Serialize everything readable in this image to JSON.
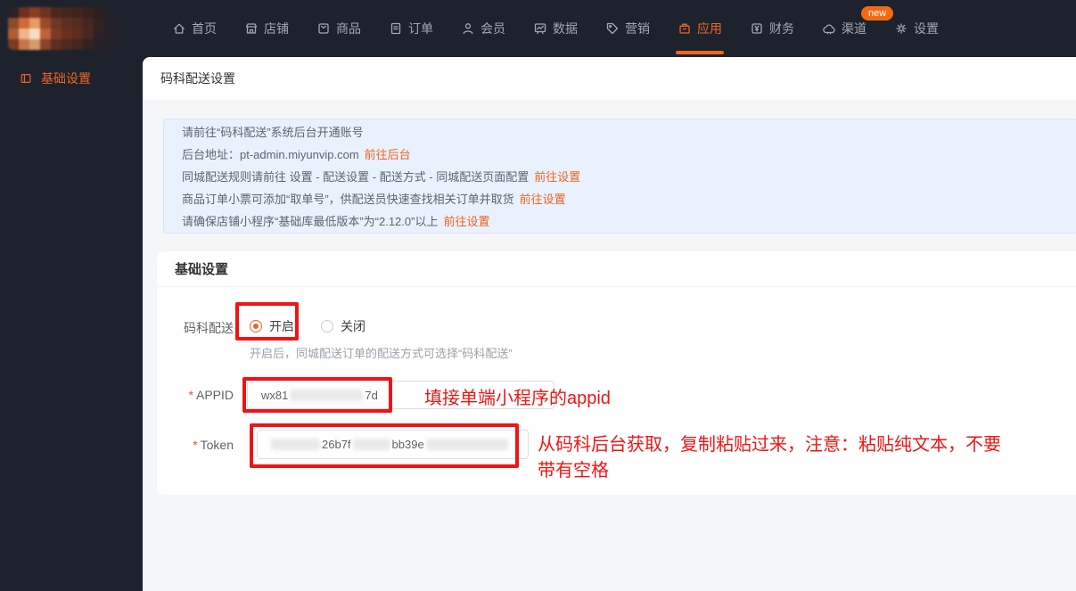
{
  "colors": {
    "accent": "#ee6425",
    "annotation_red": "#f01414",
    "dark_bg": "#1e222d",
    "notice_bg": "#e9f1fc",
    "notice_border": "#d4e3f6",
    "page_bg": "#f5f6f8"
  },
  "brand": {
    "logo_mosaic": [
      "#2a2129",
      "#6b3020",
      "#8a3d22",
      "#6e3322",
      "#4a2820",
      "#43261f",
      "#3f241e",
      "#35211f",
      "#2b1f22",
      "#242028",
      "#8a4a2c",
      "#d06a38",
      "#e89a62",
      "#9a4a28",
      "#6e3824",
      "#5e2f20",
      "#552c20",
      "#46261e",
      "#33211f",
      "#262029",
      "#b05c34",
      "#f0b488",
      "#f6dcc2",
      "#c06038",
      "#7a3a24",
      "#68301f",
      "#5c2c1e",
      "#482820",
      "#2e2027",
      "#242028",
      "#7a3a26",
      "#c4764a",
      "#d89a6a",
      "#8a4228",
      "#5e2e20",
      "#4e2a1e",
      "#44261e",
      "#33211e",
      "#282028",
      "#232028"
    ]
  },
  "topnav": {
    "items": [
      {
        "label": "首页"
      },
      {
        "label": "店铺"
      },
      {
        "label": "商品"
      },
      {
        "label": "订单"
      },
      {
        "label": "会员"
      },
      {
        "label": "数据"
      },
      {
        "label": "营销"
      },
      {
        "label": "应用"
      },
      {
        "label": "财务"
      },
      {
        "label": "渠道",
        "badge": "new"
      },
      {
        "label": "设置"
      }
    ]
  },
  "sidebar": {
    "items": [
      {
        "label": "基础设置"
      }
    ]
  },
  "page": {
    "title": "码科配送设置"
  },
  "notice": {
    "lines": [
      {
        "text": "请前往“码科配送”系统后台开通账号",
        "link": ""
      },
      {
        "text": "后台地址：pt-admin.miyunvip.com",
        "link": "前往后台"
      },
      {
        "text": "同城配送规则请前往 设置 - 配送设置 - 配送方式 - 同城配送页面配置",
        "link": "前往设置"
      },
      {
        "text": "商品订单小票可添加“取单号”，供配送员快速查找相关订单并取货",
        "link": "前往设置"
      },
      {
        "text": "请确保店铺小程序“基础库最低版本”为“2.12.0”以上",
        "link": "前往设置"
      }
    ]
  },
  "section": {
    "title": "基础设置"
  },
  "form": {
    "delivery": {
      "label": "码科配送",
      "option_on": "开启",
      "option_off": "关闭",
      "help": "开启后，同城配送订单的配送方式可选择“码科配送”"
    },
    "appid": {
      "required_mark": "*",
      "label": "APPID",
      "value_prefix": "wx81",
      "value_suffix": "7d",
      "annotation": "填接单端小程序的appid"
    },
    "token": {
      "required_mark": "*",
      "label": "Token",
      "fragment1": "26b7f",
      "fragment2": "bb39e",
      "annotation": "从码科后台获取，复制粘贴过来，注意：粘贴纯文本，不要\n带有空格"
    }
  }
}
